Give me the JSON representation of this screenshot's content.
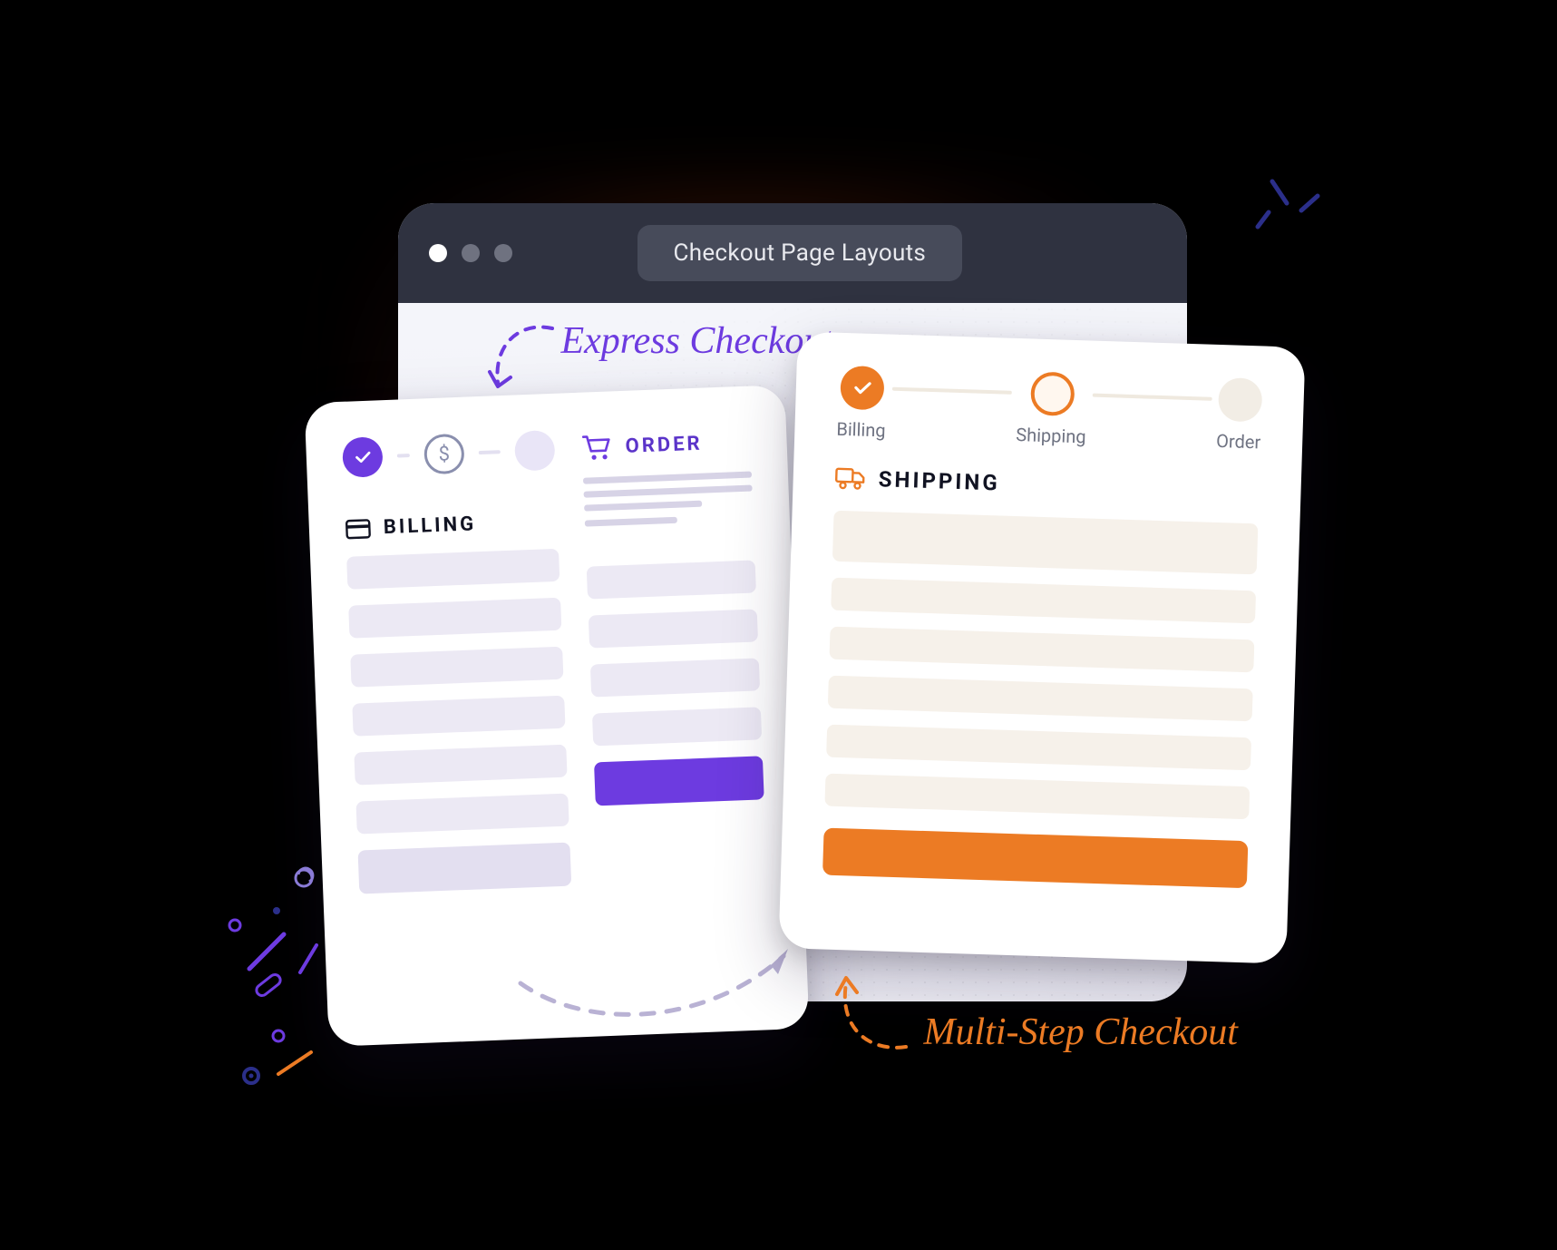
{
  "window": {
    "title": "Checkout Page Layouts"
  },
  "annotations": {
    "express": "Express Checkout",
    "multi": "Multi-Step Checkout"
  },
  "express": {
    "billing_header": "BILLING",
    "order_header": "ORDER"
  },
  "multi": {
    "steps": {
      "billing": "Billing",
      "shipping": "Shipping",
      "order": "Order"
    },
    "section_header": "SHIPPING"
  }
}
